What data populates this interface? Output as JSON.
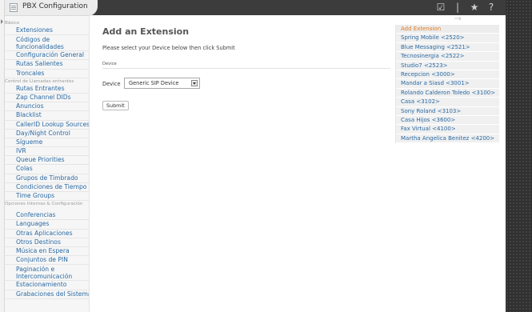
{
  "app": {
    "title": "PBX Configuration"
  },
  "topbar": {
    "icons": [
      "edit-icon",
      "logout-icon",
      "star-icon",
      "help-icon"
    ],
    "icon_glyphs": [
      "☑",
      "|→",
      "★",
      "?"
    ]
  },
  "sidebar": {
    "items": [
      {
        "type": "section",
        "label": "Básico"
      },
      {
        "type": "item",
        "label": "Extensiones"
      },
      {
        "type": "item",
        "label": "Códigos de funcionalidades",
        "wrap": true
      },
      {
        "type": "item",
        "label": "Configuración General"
      },
      {
        "type": "item",
        "label": "Rutas Salientes"
      },
      {
        "type": "item",
        "label": "Troncales"
      },
      {
        "type": "section",
        "label": "Control de Llamadas entrantes"
      },
      {
        "type": "item",
        "label": "Rutas Entrantes"
      },
      {
        "type": "item",
        "label": "Zap Channel DIDs"
      },
      {
        "type": "item",
        "label": "Anuncios"
      },
      {
        "type": "item",
        "label": "Blacklist"
      },
      {
        "type": "item",
        "label": "CallerID Lookup Sources"
      },
      {
        "type": "item",
        "label": "Day/Night Control"
      },
      {
        "type": "item",
        "label": "Sígueme"
      },
      {
        "type": "item",
        "label": "IVR"
      },
      {
        "type": "item",
        "label": "Queue Priorities"
      },
      {
        "type": "item",
        "label": "Colas"
      },
      {
        "type": "item",
        "label": "Grupos de Timbrado"
      },
      {
        "type": "item",
        "label": "Condiciones de Tiempo"
      },
      {
        "type": "item",
        "label": "Time Groups"
      },
      {
        "type": "section",
        "label": "Opciones Internas & Configuración",
        "wrap": true
      },
      {
        "type": "item",
        "label": "Conferencias"
      },
      {
        "type": "item",
        "label": "Languages"
      },
      {
        "type": "item",
        "label": "Otras Aplicaciones"
      },
      {
        "type": "item",
        "label": "Otros Destinos"
      },
      {
        "type": "item",
        "label": "Música en Espera"
      },
      {
        "type": "item",
        "label": "Conjuntos de PIN"
      },
      {
        "type": "item",
        "label": "Paginación e Intercomunicación",
        "wrap": true
      },
      {
        "type": "item",
        "label": "Estacionamiento"
      },
      {
        "type": "item",
        "label": "Grabaciones del Sistema"
      }
    ]
  },
  "main": {
    "title": "Add an Extension",
    "instructions": "Please select your Device below then click Submit",
    "section_header": "Device",
    "device_label": "Device",
    "device_select_value": "Generic SIP Device",
    "submit_label": "Submit"
  },
  "extensions_nav": {
    "items": [
      {
        "label": "Add Extension",
        "active": true
      },
      {
        "label": "Spring Mobile <2520>"
      },
      {
        "label": "Blue Messaging <2521>"
      },
      {
        "label": "Tecnosinergia <2522>"
      },
      {
        "label": "Studio7 <2523>"
      },
      {
        "label": "Recepcion <3000>"
      },
      {
        "label": "Mandar a Siasd <3001>"
      },
      {
        "label": "Rolando Calderon Toledo <3100>"
      },
      {
        "label": "Casa <3102>"
      },
      {
        "label": "Sony Roland <3103>"
      },
      {
        "label": "Casa Hijos <3600>"
      },
      {
        "label": "Fax Virtual <4100>"
      },
      {
        "label": "Martha Angelica Benitez <4200>"
      }
    ]
  },
  "colors": {
    "link": "#2b6aa3",
    "active": "#e07b20",
    "topbar": "#3c3c3c"
  }
}
